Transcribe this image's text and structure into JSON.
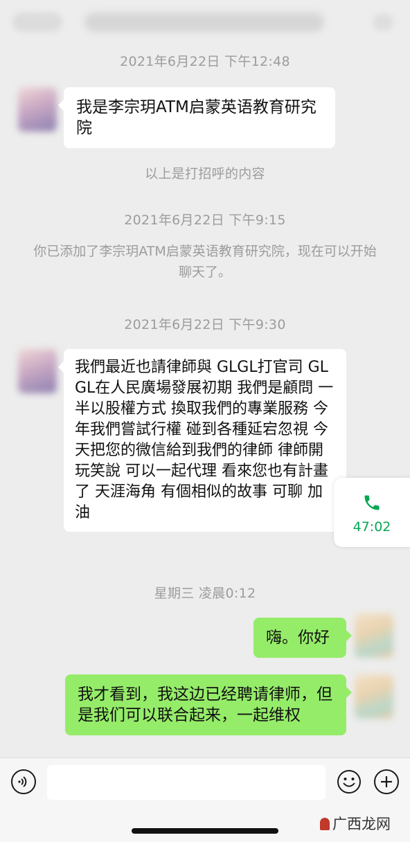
{
  "header": {
    "title": "",
    "back": "",
    "more": ""
  },
  "timestamps": {
    "t1": "2021年6月22日 下午12:48",
    "t2": "2021年6月22日 下午9:15",
    "t3": "2021年6月22日 下午9:30",
    "t4": "星期三 凌晨0:12"
  },
  "system": {
    "greeting_note": "以上是打招呼的内容",
    "added_note": "你已添加了李宗玥ATM启蒙英语教育研究院，现在可以开始聊天了。"
  },
  "messages": [
    {
      "side": "in",
      "text": "我是李宗玥ATM启蒙英语教育研究院"
    },
    {
      "side": "in",
      "text": "我們最近也請律師與 GLGL打官司  GLGL在人民廣場發展初期 我們是顧問 一半以股權方式 換取我們的專業服務 今年我們嘗試行權 碰到各種延宕忽視 今天把您的微信給到我們的律師 律師開玩笑說 可以一起代理 看來您也有計畫了 天涯海角 有個相似的故事 可聊 加油"
    },
    {
      "side": "out",
      "text": "嗨。你好"
    },
    {
      "side": "out",
      "text": "我才看到，我这边已经聘请律师，但是我们可以联合起来，一起维权"
    }
  ],
  "call": {
    "duration": "47:02",
    "icon": "phone-icon"
  },
  "input_bar": {
    "placeholder": "",
    "icons": [
      "voice-icon",
      "emoji-icon",
      "plus-icon"
    ]
  },
  "watermark": "广西龙网",
  "colors": {
    "background": "#ededed",
    "incoming_bubble": "#ffffff",
    "outgoing_bubble": "#95ec69",
    "call_green": "#07a654",
    "system_text": "#9c9c9c"
  }
}
